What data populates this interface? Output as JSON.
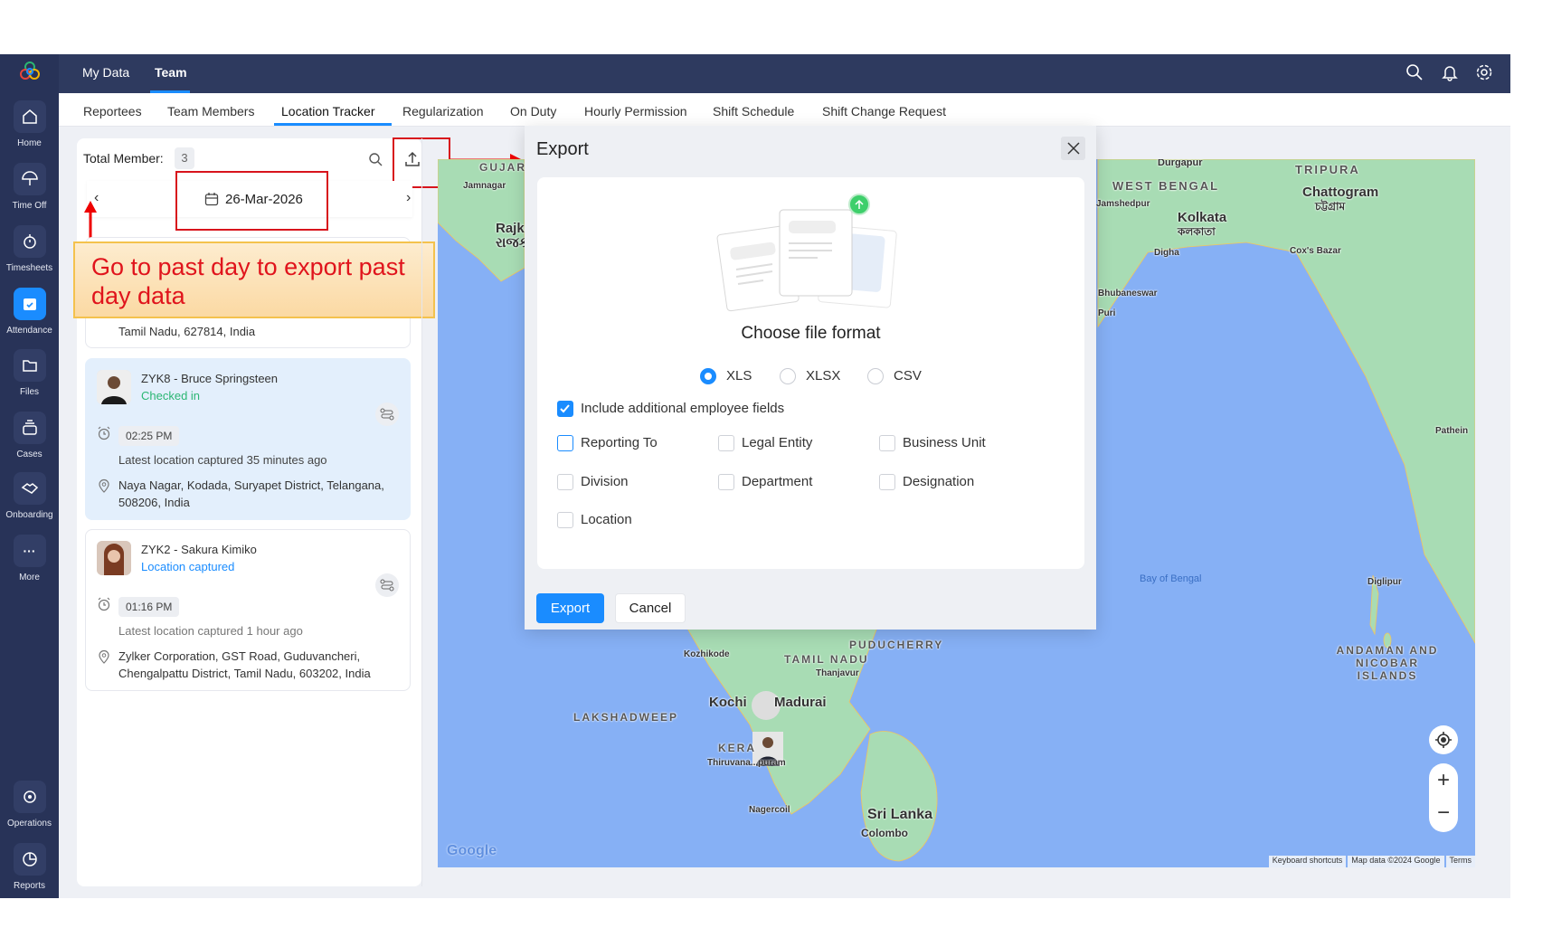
{
  "topnav": {
    "items": [
      "My Data",
      "Team"
    ],
    "active": "Team"
  },
  "sidebar": {
    "items": [
      "Home",
      "Time Off",
      "Timesheets",
      "Attendance",
      "Files",
      "Cases",
      "Onboarding",
      "More",
      "Operations",
      "Reports"
    ],
    "active": "Attendance"
  },
  "tabs": [
    "Reportees",
    "Team Members",
    "Location Tracker",
    "Regularization",
    "On Duty",
    "Hourly Permission",
    "Shift Schedule",
    "Shift Change Request"
  ],
  "active_tab": "Location Tracker",
  "panel": {
    "total_label": "Total Member:",
    "total_count": "3",
    "date": "26-Mar-2026"
  },
  "callout": {
    "text": "Go to past day to export past day data"
  },
  "members": [
    {
      "partial_address": "Tamil Nadu, 627814, India"
    },
    {
      "name": "ZYK8 - Bruce Springsteen",
      "status": "Checked in",
      "status_color": "#2bb673",
      "time": "02:25 PM",
      "latest": "Latest location captured 35 minutes ago",
      "address": "Naya Nagar, Kodada, Suryapet District, Telangana, 508206, India"
    },
    {
      "name": "ZYK2 - Sakura Kimiko",
      "status": "Location captured",
      "status_color": "#1a8cff",
      "time": "01:16 PM",
      "latest": "Latest location captured 1 hour ago",
      "address": "Zylker Corporation, GST Road, Guduvancheri, Chengalpattu District, Tamil Nadu, 603202, India"
    }
  ],
  "modal": {
    "title": "Export",
    "heading": "Choose file format",
    "formats": [
      "XLS",
      "XLSX",
      "CSV"
    ],
    "selected_format": "XLS",
    "include_label": "Include additional employee fields",
    "include_checked": true,
    "fields": [
      "Reporting To",
      "Legal Entity",
      "Business Unit",
      "Division",
      "Department",
      "Designation",
      "Location"
    ],
    "export_label": "Export",
    "cancel_label": "Cancel"
  },
  "map": {
    "labels": [
      "GUJAR",
      "Jamnagar",
      "Rajkot",
      "રાજકો",
      "Durgapur",
      "WEST BENGAL",
      "Jamshedpur",
      "Kolkata",
      "কলকাতা",
      "Digha",
      "TRIPURA",
      "Chattogram",
      "চট্টগ্রাম",
      "Cox's Bazar",
      "Bay of Bengal",
      "Diglipur",
      "ANDAMAN AND NICOBAR ISLANDS",
      "Pathein",
      "PUDUCHERRY",
      "TAMIL NADU",
      "Kozhikode",
      "Thanjavur",
      "Kochi",
      "Madurai",
      "LAKSHADWEEP",
      "KERA",
      "Thiruvana...puram",
      "Nagercoil",
      "Sri Lanka",
      "Colombo",
      "Bhubaneswar",
      "Puri"
    ],
    "footer": [
      "Keyboard shortcuts",
      "Map data ©2024 Google",
      "Terms"
    ],
    "logo": "Google"
  }
}
